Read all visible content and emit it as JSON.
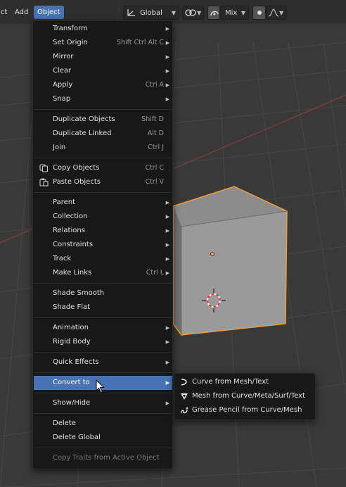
{
  "header": {
    "menus": [
      "ct",
      "Add",
      "Object"
    ],
    "orientation": "Global",
    "proportional_mode": "Mix"
  },
  "object_menu": {
    "groups": [
      [
        {
          "label": "Transform",
          "shortcut": "",
          "submenu": true
        },
        {
          "label": "Set Origin",
          "shortcut": "Shift Ctrl Alt C",
          "submenu": true
        },
        {
          "label": "Mirror",
          "shortcut": "",
          "submenu": true
        },
        {
          "label": "Clear",
          "shortcut": "",
          "submenu": true
        },
        {
          "label": "Apply",
          "shortcut": "Ctrl A",
          "submenu": true
        },
        {
          "label": "Snap",
          "shortcut": "",
          "submenu": true
        }
      ],
      [
        {
          "label": "Duplicate Objects",
          "shortcut": "Shift D",
          "submenu": false
        },
        {
          "label": "Duplicate Linked",
          "shortcut": "Alt D",
          "submenu": false
        },
        {
          "label": "Join",
          "shortcut": "Ctrl J",
          "submenu": false
        }
      ],
      [
        {
          "label": "Copy Objects",
          "shortcut": "Ctrl C",
          "submenu": false,
          "icon": "copy-icon"
        },
        {
          "label": "Paste Objects",
          "shortcut": "Ctrl V",
          "submenu": false,
          "icon": "paste-icon"
        }
      ],
      [
        {
          "label": "Parent",
          "shortcut": "",
          "submenu": true
        },
        {
          "label": "Collection",
          "shortcut": "",
          "submenu": true
        },
        {
          "label": "Relations",
          "shortcut": "",
          "submenu": true
        },
        {
          "label": "Constraints",
          "shortcut": "",
          "submenu": true
        },
        {
          "label": "Track",
          "shortcut": "",
          "submenu": true
        },
        {
          "label": "Make Links",
          "shortcut": "Ctrl L",
          "submenu": true
        }
      ],
      [
        {
          "label": "Shade Smooth",
          "shortcut": "",
          "submenu": false
        },
        {
          "label": "Shade Flat",
          "shortcut": "",
          "submenu": false
        }
      ],
      [
        {
          "label": "Animation",
          "shortcut": "",
          "submenu": true
        },
        {
          "label": "Rigid Body",
          "shortcut": "",
          "submenu": true
        }
      ],
      [
        {
          "label": "Quick Effects",
          "shortcut": "",
          "submenu": true
        }
      ],
      [
        {
          "label": "Convert to",
          "shortcut": "",
          "submenu": true,
          "active": true
        }
      ],
      [
        {
          "label": "Show/Hide",
          "shortcut": "",
          "submenu": true
        }
      ],
      [
        {
          "label": "Delete",
          "shortcut": "",
          "submenu": false
        },
        {
          "label": "Delete Global",
          "shortcut": "",
          "submenu": false
        }
      ],
      [
        {
          "label": "Copy Traits from Active Object",
          "shortcut": "",
          "submenu": false,
          "disabled": true
        }
      ]
    ]
  },
  "convert_submenu": {
    "items": [
      {
        "label": "Curve from Mesh/Text",
        "icon": "curve-icon"
      },
      {
        "label": "Mesh from Curve/Meta/Surf/Text",
        "icon": "mesh-icon"
      },
      {
        "label": "Grease Pencil from Curve/Mesh",
        "icon": "grease-pencil-icon"
      }
    ]
  },
  "colors": {
    "accent": "#4772b3",
    "menu_bg": "#181818",
    "viewport_bg": "#393939",
    "selection_outline": "#f39c3c"
  }
}
